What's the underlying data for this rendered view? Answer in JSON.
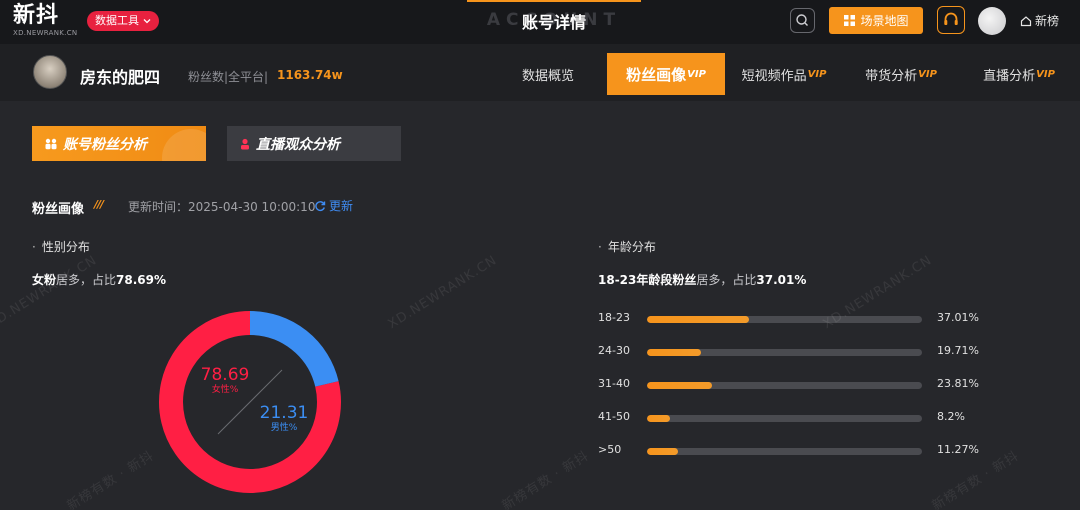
{
  "topbar": {
    "logo": "新抖",
    "logo_sub": "XD.NEWRANK.CN",
    "tool_menu": "数据工具",
    "page_title": "账号详情",
    "page_title_bg": "ACCOUNT",
    "scene_map": "场景地图",
    "rank_link": "新榜"
  },
  "account": {
    "name": "房东的肥四",
    "fans_label": "粉丝数|全平台|",
    "fans_value": "1163.74w"
  },
  "nav": {
    "tabs": [
      {
        "label": "数据概览",
        "vip": ""
      },
      {
        "label": "粉丝画像",
        "vip": "VIP"
      },
      {
        "label": "短视频作品",
        "vip": "VIP"
      },
      {
        "label": "带货分析",
        "vip": "VIP"
      },
      {
        "label": "直播分析",
        "vip": "VIP"
      }
    ]
  },
  "subtabs": {
    "account_fans": "账号粉丝分析",
    "live_audience": "直播观众分析"
  },
  "section": {
    "title": "粉丝画像",
    "updated": "更新时间：2025-04-30 10:00:10",
    "refresh": "更新"
  },
  "gender": {
    "title": "性别分布",
    "summary_prefix": "女粉",
    "summary_middle": "居多，占比",
    "summary_value": "78.69%",
    "female_value": "78.69",
    "female_label": "女性%",
    "male_value": "21.31",
    "male_label": "男性%",
    "female_color": "#ff1f44",
    "male_color": "#3b8ef3"
  },
  "age": {
    "title": "年龄分布",
    "summary_prefix": "18-23年龄段粉丝",
    "summary_middle": "居多，占比",
    "summary_value": "37.01%",
    "rows": [
      {
        "label": "18-23",
        "value": "37.01%",
        "pct": 37.01
      },
      {
        "label": "24-30",
        "value": "19.71%",
        "pct": 19.71
      },
      {
        "label": "31-40",
        "value": "23.81%",
        "pct": 23.81
      },
      {
        "label": "41-50",
        "value": "8.2%",
        "pct": 8.2
      },
      {
        "label": ">50",
        "value": "11.27%",
        "pct": 11.27
      }
    ]
  },
  "watermarks": {
    "domain": "XD.NEWRANK.CN",
    "slogan": "新榜有数 · 新抖"
  }
}
